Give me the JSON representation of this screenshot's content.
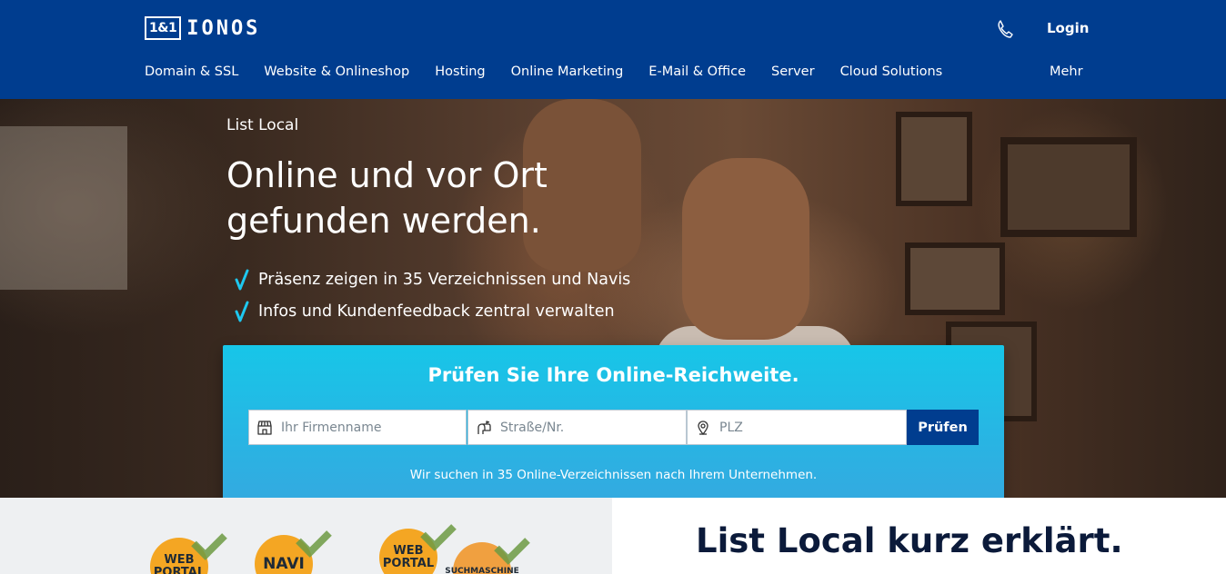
{
  "header": {
    "logo_box": "1&1",
    "logo_text": "IONOS",
    "login": "Login",
    "nav": [
      "Domain & SSL",
      "Website & Onlineshop",
      "Hosting",
      "Online Marketing",
      "E-Mail & Office",
      "Server",
      "Cloud Solutions"
    ],
    "more": "Mehr",
    "icons": {
      "phone": "phone-icon"
    }
  },
  "hero": {
    "eyebrow": "List Local",
    "headline_line1": "Online und vor Ort",
    "headline_line2": "gefunden werden.",
    "bullets": [
      "Präsenz zeigen in 35 Verzeichnissen und Navis",
      "Infos und Kundenfeedback zentral verwalten"
    ]
  },
  "search": {
    "title": "Prüfen Sie Ihre Online-Reichweite.",
    "company_placeholder": "Ihr Firmenname",
    "street_placeholder": "Straße/Nr.",
    "zip_placeholder": "PLZ",
    "button": "Prüfen",
    "note": "Wir suchen in 35 Online-Verzeichnissen nach Ihrem Unternehmen."
  },
  "lower": {
    "title": "List Local kurz erklärt.",
    "badges": [
      "WEB PORTAL",
      "NAVI",
      "WEB PORTAL",
      "SUCHMASCHINE"
    ]
  },
  "colors": {
    "brand": "#003d8f",
    "search_top": "#17c6e8",
    "search_bottom": "#34a9e0",
    "check": "#1ec8f0"
  }
}
